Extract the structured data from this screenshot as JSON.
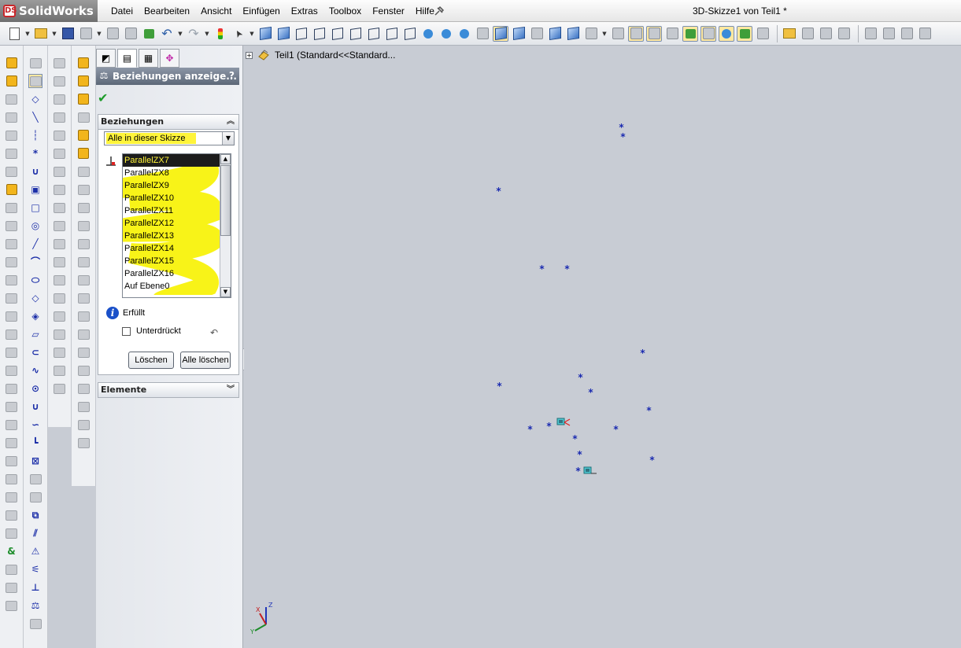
{
  "app": {
    "name": "SolidWorks",
    "logo_letters": "DS"
  },
  "menu": [
    "Datei",
    "Bearbeiten",
    "Ansicht",
    "Einfügen",
    "Extras",
    "Toolbox",
    "Fenster",
    "Hilfe"
  ],
  "document_title": "3D-Skizze1 von Teil1 *",
  "property_manager": {
    "title": "Beziehungen anzeige...",
    "help": "?",
    "relations_group": {
      "header": "Beziehungen",
      "filter_value": "Alle in dieser Skizze",
      "items": [
        "ParallelZX7",
        "ParallelZX8",
        "ParallelZX9",
        "ParallelZX10",
        "ParallelZX11",
        "ParallelZX12",
        "ParallelZX13",
        "ParallelZX14",
        "ParallelZX15",
        "ParallelZX16",
        "Auf Ebene0"
      ],
      "selected_index": 0,
      "status_text": "Erfüllt",
      "suppressed_label": "Unterdrückt",
      "suppressed_checked": false,
      "delete_label": "Löschen",
      "delete_all_label": "Alle löschen"
    },
    "elements_group": {
      "header": "Elemente"
    }
  },
  "feature_tree": {
    "root_label": "Teil1  (Standard<<Standard..."
  },
  "triad_axes": [
    "X",
    "Y",
    "Z"
  ],
  "colors": {
    "highlight": "#fff43a",
    "sketch_point": "#1a2ab0",
    "header": "#6b7585"
  }
}
